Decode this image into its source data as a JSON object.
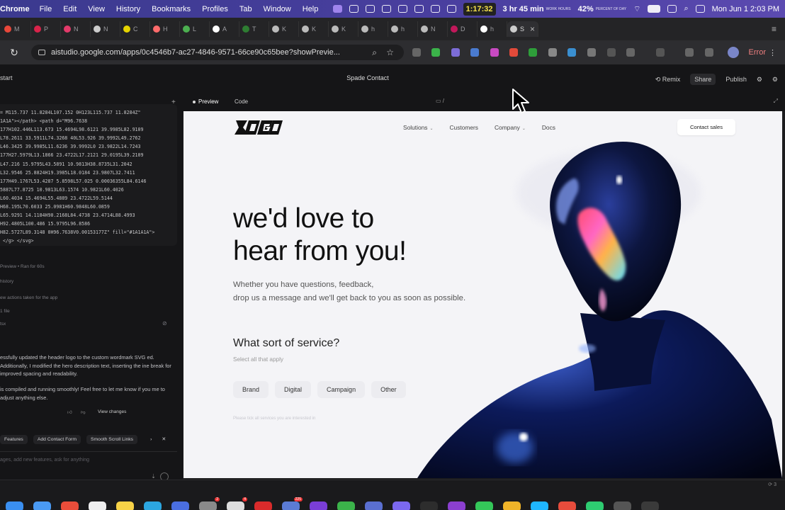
{
  "menubar": {
    "app": "Chrome",
    "items": [
      "File",
      "Edit",
      "View",
      "History",
      "Bookmarks",
      "Profiles",
      "Tab",
      "Window",
      "Help"
    ],
    "timer": "1:17:32",
    "work_hours": "3 hr 45 min",
    "work_hours_caption": "WORK HOURS",
    "percent": "42%",
    "percent_caption": "PERCENT OF DAY",
    "clock": "Mon Jun 1  2:03 PM"
  },
  "tabs": [
    {
      "label": "M",
      "color": "#e8473a"
    },
    {
      "label": "P",
      "color": "#d8234a"
    },
    {
      "label": "N",
      "color": "#e33a6a"
    },
    {
      "label": "N",
      "color": "#cccccc"
    },
    {
      "label": "C",
      "color": "#e6d400"
    },
    {
      "label": "H",
      "color": "#ff6b6b"
    },
    {
      "label": "L",
      "color": "#4caf50"
    },
    {
      "label": "A",
      "color": "#ffffff"
    },
    {
      "label": "T",
      "color": "#2e7d32"
    },
    {
      "label": "K",
      "color": "#bbbbbb"
    },
    {
      "label": "K",
      "color": "#bbbbbb"
    },
    {
      "label": "K",
      "color": "#bbbbbb"
    },
    {
      "label": "h",
      "color": "#bbbbbb"
    },
    {
      "label": "h",
      "color": "#bbbbbb"
    },
    {
      "label": "N",
      "color": "#bbbbbb"
    },
    {
      "label": "D",
      "color": "#c2185b"
    },
    {
      "label": "h",
      "color": "#ffffff"
    },
    {
      "label": "S",
      "color": "#cccccc",
      "active": true
    }
  ],
  "address": {
    "url": "aistudio.google.com/apps/0c4546b7-ac27-4846-9571-66ce90c65bee?showPrevie...",
    "error_label": "Error"
  },
  "appbar": {
    "start": "start",
    "title": "Spade Contact",
    "remix": "Remix",
    "share": "Share",
    "publish": "Publish"
  },
  "leftpanel": {
    "code_lines": [
      "= M115.737 11.8284L107.152 0H123L115.737 11.8284Z\"",
      "1A1A\"></path> <path d=\"M96.7638",
      "177H102.446L113.673 15.4694L98.6121 39.9985L82.9109",
      "L78.2611 33.5911L74.3268 40L53.926 39.9992L49.2762",
      "L46.3425 39.9985L11.6236 39.9992L0 23.9822L14.7243",
      "177H27.5979L13.1866 23.4722L17.2121 29.0195L39.2109",
      "L47.216 15.9795L43.5891 10.9813H38.8735L31.2042",
      "L32.9546 25.8824H19.3985L18.0184 23.9807L32.7411",
      "177H49.1767L53.4287 5.8598L57.025 0.00036355L84.6146",
      "5887L77.8725 10.9813L63.1574 10.9821L60.4026",
      "L60.4034 15.4694L55.4889 23.4722L59.5144",
      "H68.195L70.6033 25.0981H60.9848L60.0859",
      "L65.9291 14.1184H90.2168L84.4738 23.4714L88.4993",
      "H92.4805L100.486 15.9795L96.8586",
      "H82.5727L89.3148 0H96.7638V0.00153177Z\" fill=\"#1A1A1A\">",
      " </g> </svg>"
    ],
    "meta1": "Preview  •  Ran for 60s",
    "meta2": "history",
    "meta3": "ew actions taken for the app",
    "meta4": "1 file",
    "meta5": "tsx",
    "message1": "essfully updated the header logo to the custom wordmark SVG ed. Additionally, I modified the hero description text, inserting the ine break for improved spacing and readability.",
    "message2": "is compiled and running smoothly! Feel free to let me know if you me to adjust anything else.",
    "view_changes": "View changes",
    "chips": [
      "Features",
      "Add Contact Form",
      "Smooth Scroll Links"
    ],
    "prompt_placeholder": "ages, add new features, ask for anything"
  },
  "preview_bar": {
    "tab_preview": "Preview",
    "tab_code": "Code",
    "route": "/"
  },
  "site": {
    "nav": [
      "Solutions",
      "Customers",
      "Company",
      "Docs"
    ],
    "cta": "Contact sales",
    "hero_line1": "we'd love to",
    "hero_line2": "hear from you!",
    "desc_line1": "Whether you have questions, feedback,",
    "desc_line2": "drop us a message and we'll get back to you as soon as possible.",
    "service_title": "What sort of service?",
    "service_sub": "Select all that apply",
    "options": [
      "Brand",
      "Digital",
      "Campaign",
      "Other"
    ],
    "hint": "Please tick all services you are interested in"
  },
  "dock": {
    "status": "⟳ 3",
    "apps": [
      {
        "color": "#3a8ff0"
      },
      {
        "color": "#4a9af3"
      },
      {
        "color": "#e94d3a"
      },
      {
        "color": "#eeeeee"
      },
      {
        "color": "#f7d247"
      },
      {
        "color": "#2ca6e0"
      },
      {
        "color": "#4a6ee0"
      },
      {
        "color": "#8a8a8a",
        "badge": "2"
      },
      {
        "color": "#dddddd",
        "badge": "4"
      },
      {
        "color": "#d92b2b"
      },
      {
        "color": "#5b7bd5",
        "badge": "225"
      },
      {
        "color": "#7a3ed6"
      },
      {
        "color": "#3bb34a"
      },
      {
        "color": "#5a6fd0"
      },
      {
        "color": "#7b68ee"
      },
      {
        "color": "#2d2d2d"
      },
      {
        "color": "#8b3fd0"
      },
      {
        "color": "#34c759"
      },
      {
        "color": "#f0b429"
      },
      {
        "color": "#1fb6ff"
      },
      {
        "color": "#e74c3c"
      },
      {
        "color": "#2ecc71"
      },
      {
        "color": "#555555"
      },
      {
        "color": "#3a3a3a"
      }
    ]
  }
}
